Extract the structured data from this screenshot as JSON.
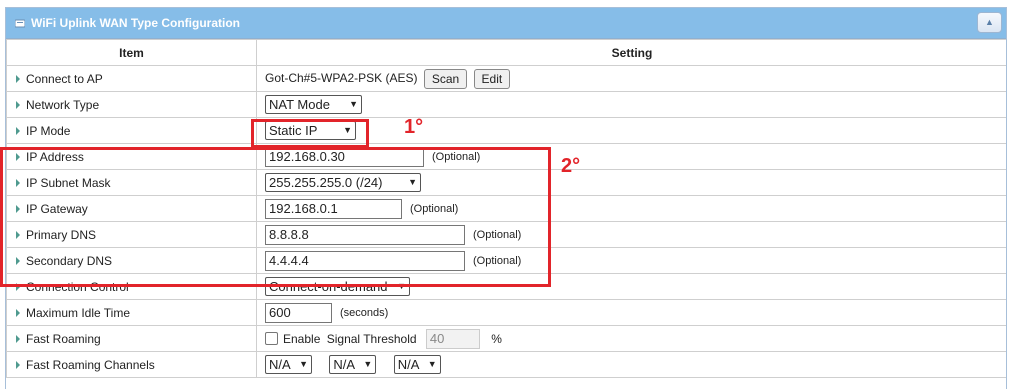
{
  "panel": {
    "title": "WiFi Uplink WAN Type Configuration"
  },
  "columns": {
    "item": "Item",
    "setting": "Setting"
  },
  "rows": {
    "connect_ap": {
      "label": "Connect to AP",
      "value": "Got-Ch#5-WPA2-PSK (AES)",
      "scan": "Scan",
      "edit": "Edit"
    },
    "network_type": {
      "label": "Network Type",
      "value": "NAT Mode"
    },
    "ip_mode": {
      "label": "IP Mode",
      "value": "Static IP"
    },
    "ip_address": {
      "label": "IP Address",
      "value": "192.168.0.30",
      "hint": "(Optional)"
    },
    "subnet": {
      "label": "IP Subnet Mask",
      "value": "255.255.255.0 (/24)"
    },
    "gateway": {
      "label": "IP Gateway",
      "value": "192.168.0.1",
      "hint": "(Optional)"
    },
    "dns1": {
      "label": "Primary DNS",
      "value": "8.8.8.8",
      "hint": "(Optional)"
    },
    "dns2": {
      "label": "Secondary DNS",
      "value": "4.4.4.4",
      "hint": "(Optional)"
    },
    "conn_control": {
      "label": "Connection Control",
      "value": "Connect-on-demand"
    },
    "idle_time": {
      "label": "Maximum Idle Time",
      "value": "600",
      "hint": "(seconds)"
    },
    "fast_roaming": {
      "label": "Fast Roaming",
      "enable_label": "Enable",
      "threshold_label": "Signal Threshold",
      "threshold_value": "40",
      "unit": "%"
    },
    "roaming_channels": {
      "label": "Fast Roaming Channels",
      "ch1": "N/A",
      "ch2": "N/A",
      "ch3": "N/A"
    }
  },
  "annotations": {
    "first": "1°",
    "second": "2°"
  },
  "colors": {
    "title_bar": "#86bde8",
    "annotation": "#e2242a",
    "arrow": "#4f9a8f"
  },
  "icons": {
    "title": "panel-icon",
    "collapse": "chevron-up-icon",
    "row_marker": "triangle-right-icon"
  }
}
